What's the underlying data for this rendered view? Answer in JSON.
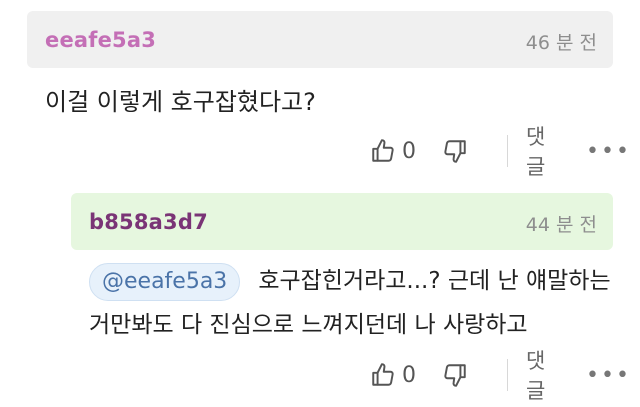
{
  "comment": {
    "username": "eeafe5a3",
    "time": "46 분 전",
    "text": "이걸 이렇게 호구잡혔다고?",
    "likes": "0",
    "reply_label": "댓글",
    "more_label": "•••"
  },
  "reply": {
    "username": "b858a3d7",
    "time": "44 분 전",
    "mention": "@eeafe5a3",
    "text_line1": "호구잡힌거라고...? 근데 난 얘말하는",
    "text_line2": "거만봐도 다 진심으로 느껴지던데 나 사랑하고",
    "likes": "0",
    "reply_label": "댓글",
    "more_label": "•••"
  },
  "colors": {
    "username_1": "#c46fb6",
    "username_2": "#7a3476",
    "header_1_bg": "#f0f0f0",
    "header_2_bg": "#e6f7df"
  }
}
